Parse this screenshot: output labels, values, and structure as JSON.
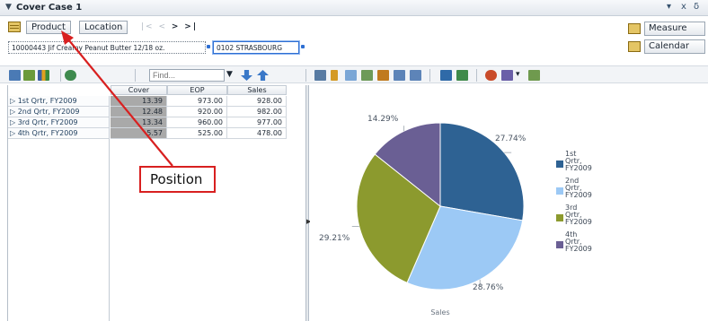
{
  "window": {
    "title": "Cover Case 1",
    "twisty": "▼",
    "controls": [
      "▾",
      "x",
      "δ"
    ]
  },
  "dimensions": {
    "tiles": [
      "Product",
      "Location"
    ],
    "nav": {
      "first": "|<",
      "prev": "<",
      "next": ">",
      "last": ">|"
    },
    "values": [
      {
        "text": "10000443 Jif Creamy Peanut Butter 12/18 oz."
      },
      {
        "text": "0102 STRASBOURG"
      }
    ],
    "side": [
      {
        "label": "Measure"
      },
      {
        "label": "Calendar"
      }
    ]
  },
  "toolbar": {
    "find_placeholder": "Find..."
  },
  "grid": {
    "columns": [
      "Cover",
      "EOP",
      "Sales"
    ],
    "rows": [
      {
        "label": "▷ 1st Qrtr, FY2009",
        "values": [
          "13.39",
          "973.00",
          "928.00"
        ]
      },
      {
        "label": "▷ 2nd Qrtr, FY2009",
        "values": [
          "12.48",
          "920.00",
          "982.00"
        ]
      },
      {
        "label": "▷ 3rd Qrtr, FY2009",
        "values": [
          "13.34",
          "960.00",
          "977.00"
        ]
      },
      {
        "label": "▷ 4th Qrtr, FY2009",
        "values": [
          "5.57",
          "525.00",
          "478.00"
        ]
      }
    ]
  },
  "colors": {
    "q1": "#2e6293",
    "q2": "#9cc9f5",
    "q3": "#8c9a2e",
    "q4": "#6a5f94",
    "accent": "#d82020"
  },
  "chart_data": {
    "type": "pie",
    "title": "",
    "xlabel": "Sales",
    "categories": [
      "1st Qrtr, FY2009",
      "2nd Qrtr, FY2009",
      "3rd Qrtr, FY2009",
      "4th Qrtr, FY2009"
    ],
    "values": [
      27.74,
      28.76,
      29.21,
      14.29
    ],
    "labels": [
      "27.74%",
      "28.76%",
      "29.21%",
      "14.29%"
    ],
    "legend": {
      "position": "right",
      "entries": [
        [
          "1st",
          "Qrtr,",
          "FY2009"
        ],
        [
          "2nd",
          "Qrtr,",
          "FY2009"
        ],
        [
          "3rd",
          "Qrtr,",
          "FY2009"
        ],
        [
          "4th",
          "Qrtr,",
          "FY2009"
        ]
      ]
    }
  },
  "annotation": {
    "text": "Position"
  }
}
